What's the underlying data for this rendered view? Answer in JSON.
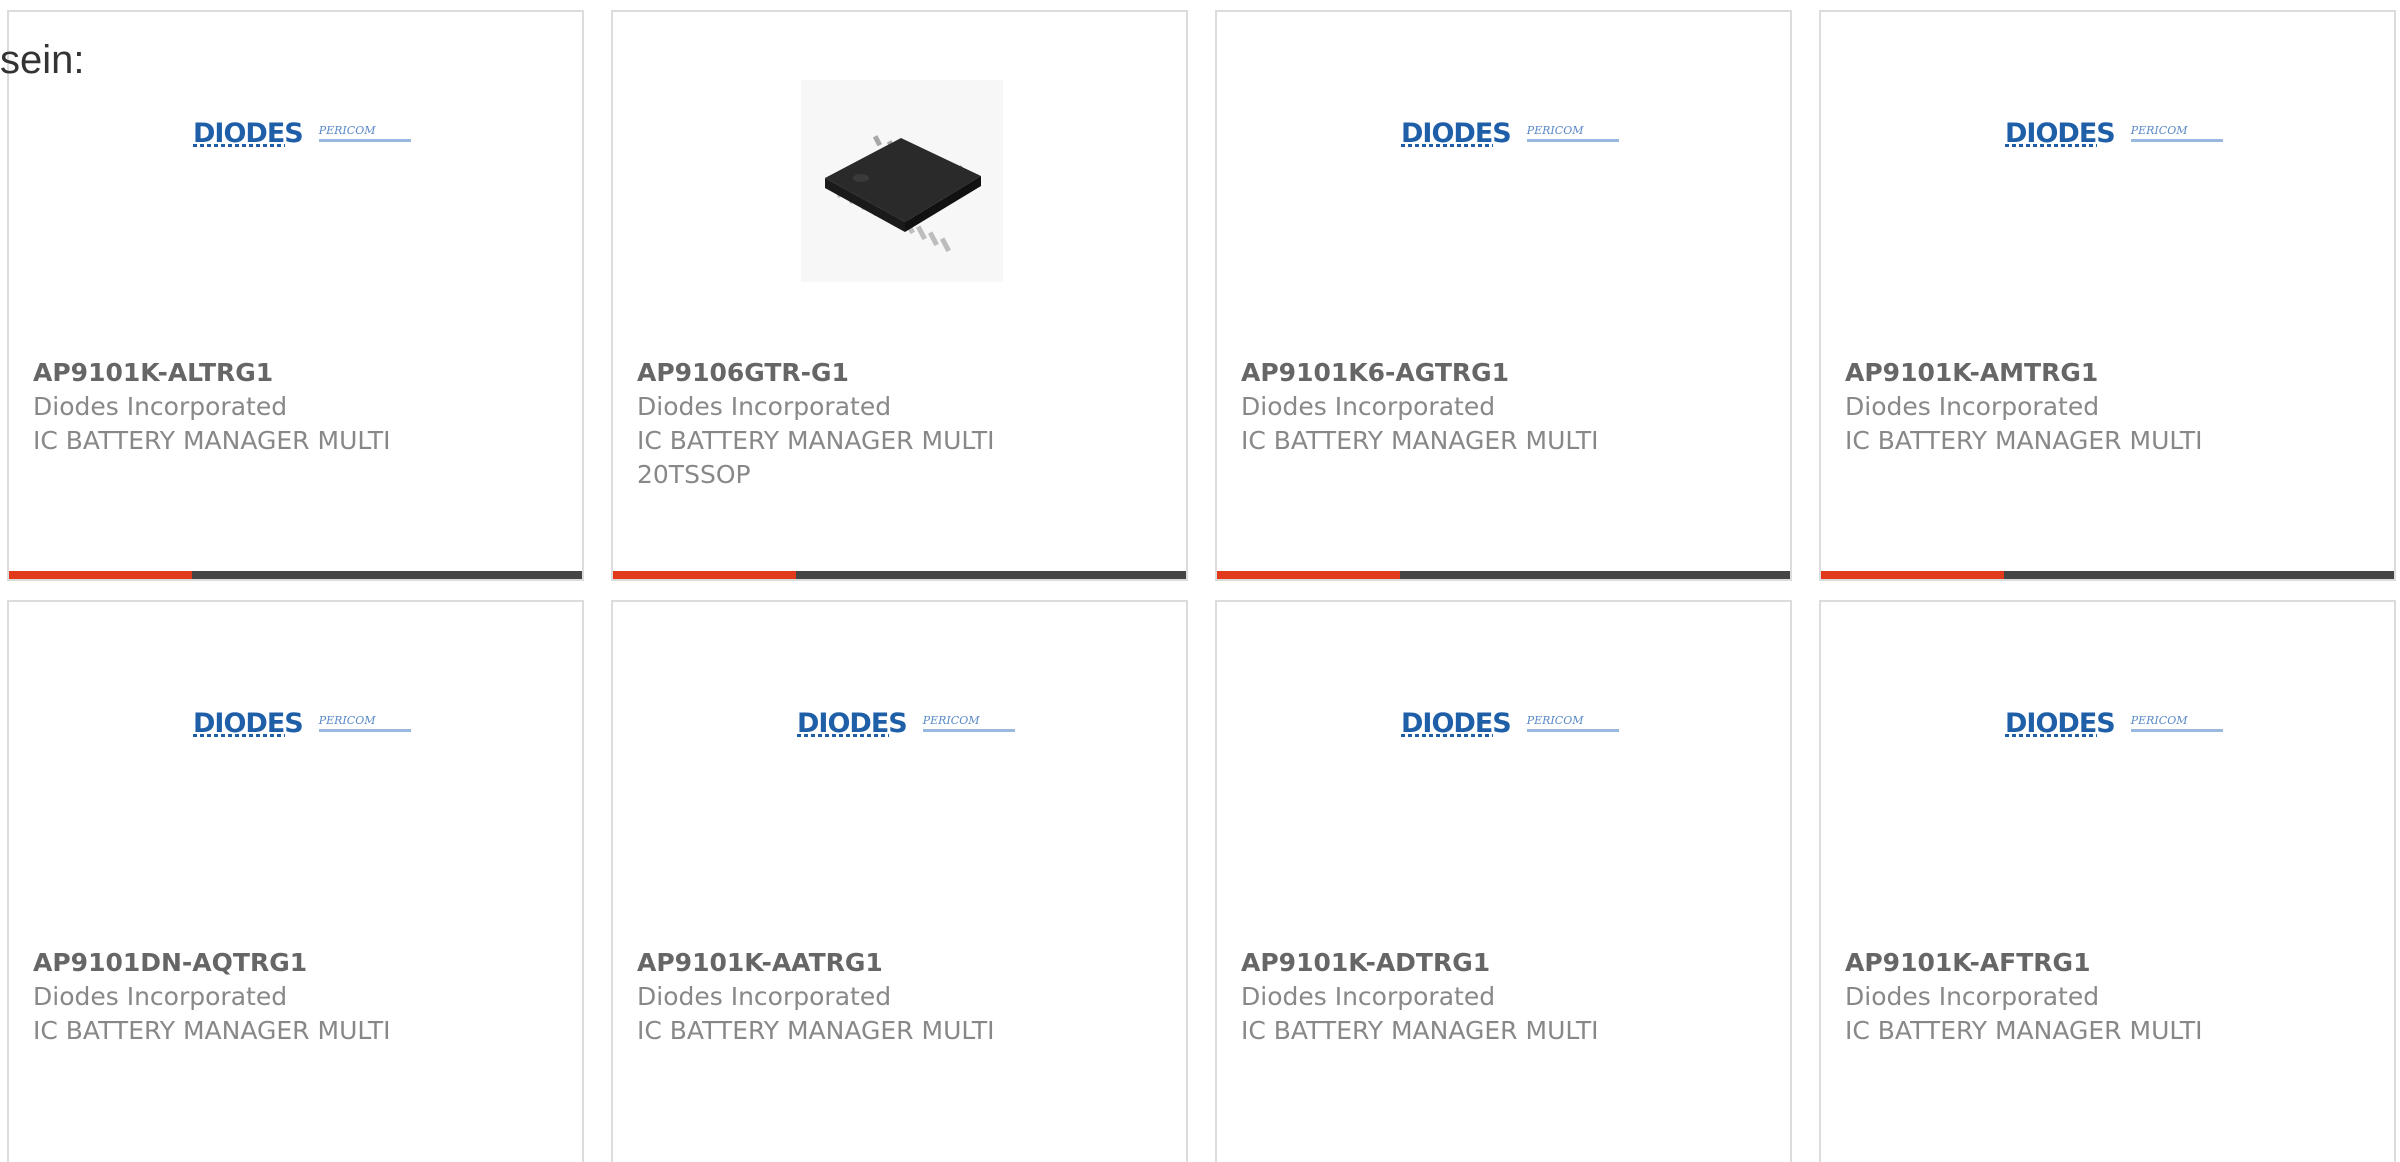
{
  "lead_text": "sein:",
  "colors": {
    "accent": "#e03a1a",
    "bar": "#444444",
    "brand_blue": "#1f5fa8"
  },
  "logo": {
    "brand": "DIODES",
    "sub_brand": "PERICOM"
  },
  "products": [
    {
      "part": "AP9101K-ALTRG1",
      "manufacturer": "Diodes Incorporated",
      "description": "IC BATTERY MANAGER MULTI",
      "image": "diodes-pericom-logo"
    },
    {
      "part": "AP9106GTR-G1",
      "manufacturer": "Diodes Incorporated",
      "description": "IC BATTERY MANAGER MULTI 20TSSOP",
      "image": "tssop-chip"
    },
    {
      "part": "AP9101K6-AGTRG1",
      "manufacturer": "Diodes Incorporated",
      "description": "IC BATTERY MANAGER MULTI",
      "image": "diodes-pericom-logo"
    },
    {
      "part": "AP9101K-AMTRG1",
      "manufacturer": "Diodes Incorporated",
      "description": "IC BATTERY MANAGER MULTI",
      "image": "diodes-pericom-logo"
    },
    {
      "part": "AP9101DN-AQTRG1",
      "manufacturer": "Diodes Incorporated",
      "description": "IC BATTERY MANAGER MULTI",
      "image": "diodes-pericom-logo"
    },
    {
      "part": "AP9101K-AATRG1",
      "manufacturer": "Diodes Incorporated",
      "description": "IC BATTERY MANAGER MULTI",
      "image": "diodes-pericom-logo"
    },
    {
      "part": "AP9101K-ADTRG1",
      "manufacturer": "Diodes Incorporated",
      "description": "IC BATTERY MANAGER MULTI",
      "image": "diodes-pericom-logo"
    },
    {
      "part": "AP9101K-AFTRG1",
      "manufacturer": "Diodes Incorporated",
      "description": "IC BATTERY MANAGER MULTI",
      "image": "diodes-pericom-logo"
    }
  ]
}
